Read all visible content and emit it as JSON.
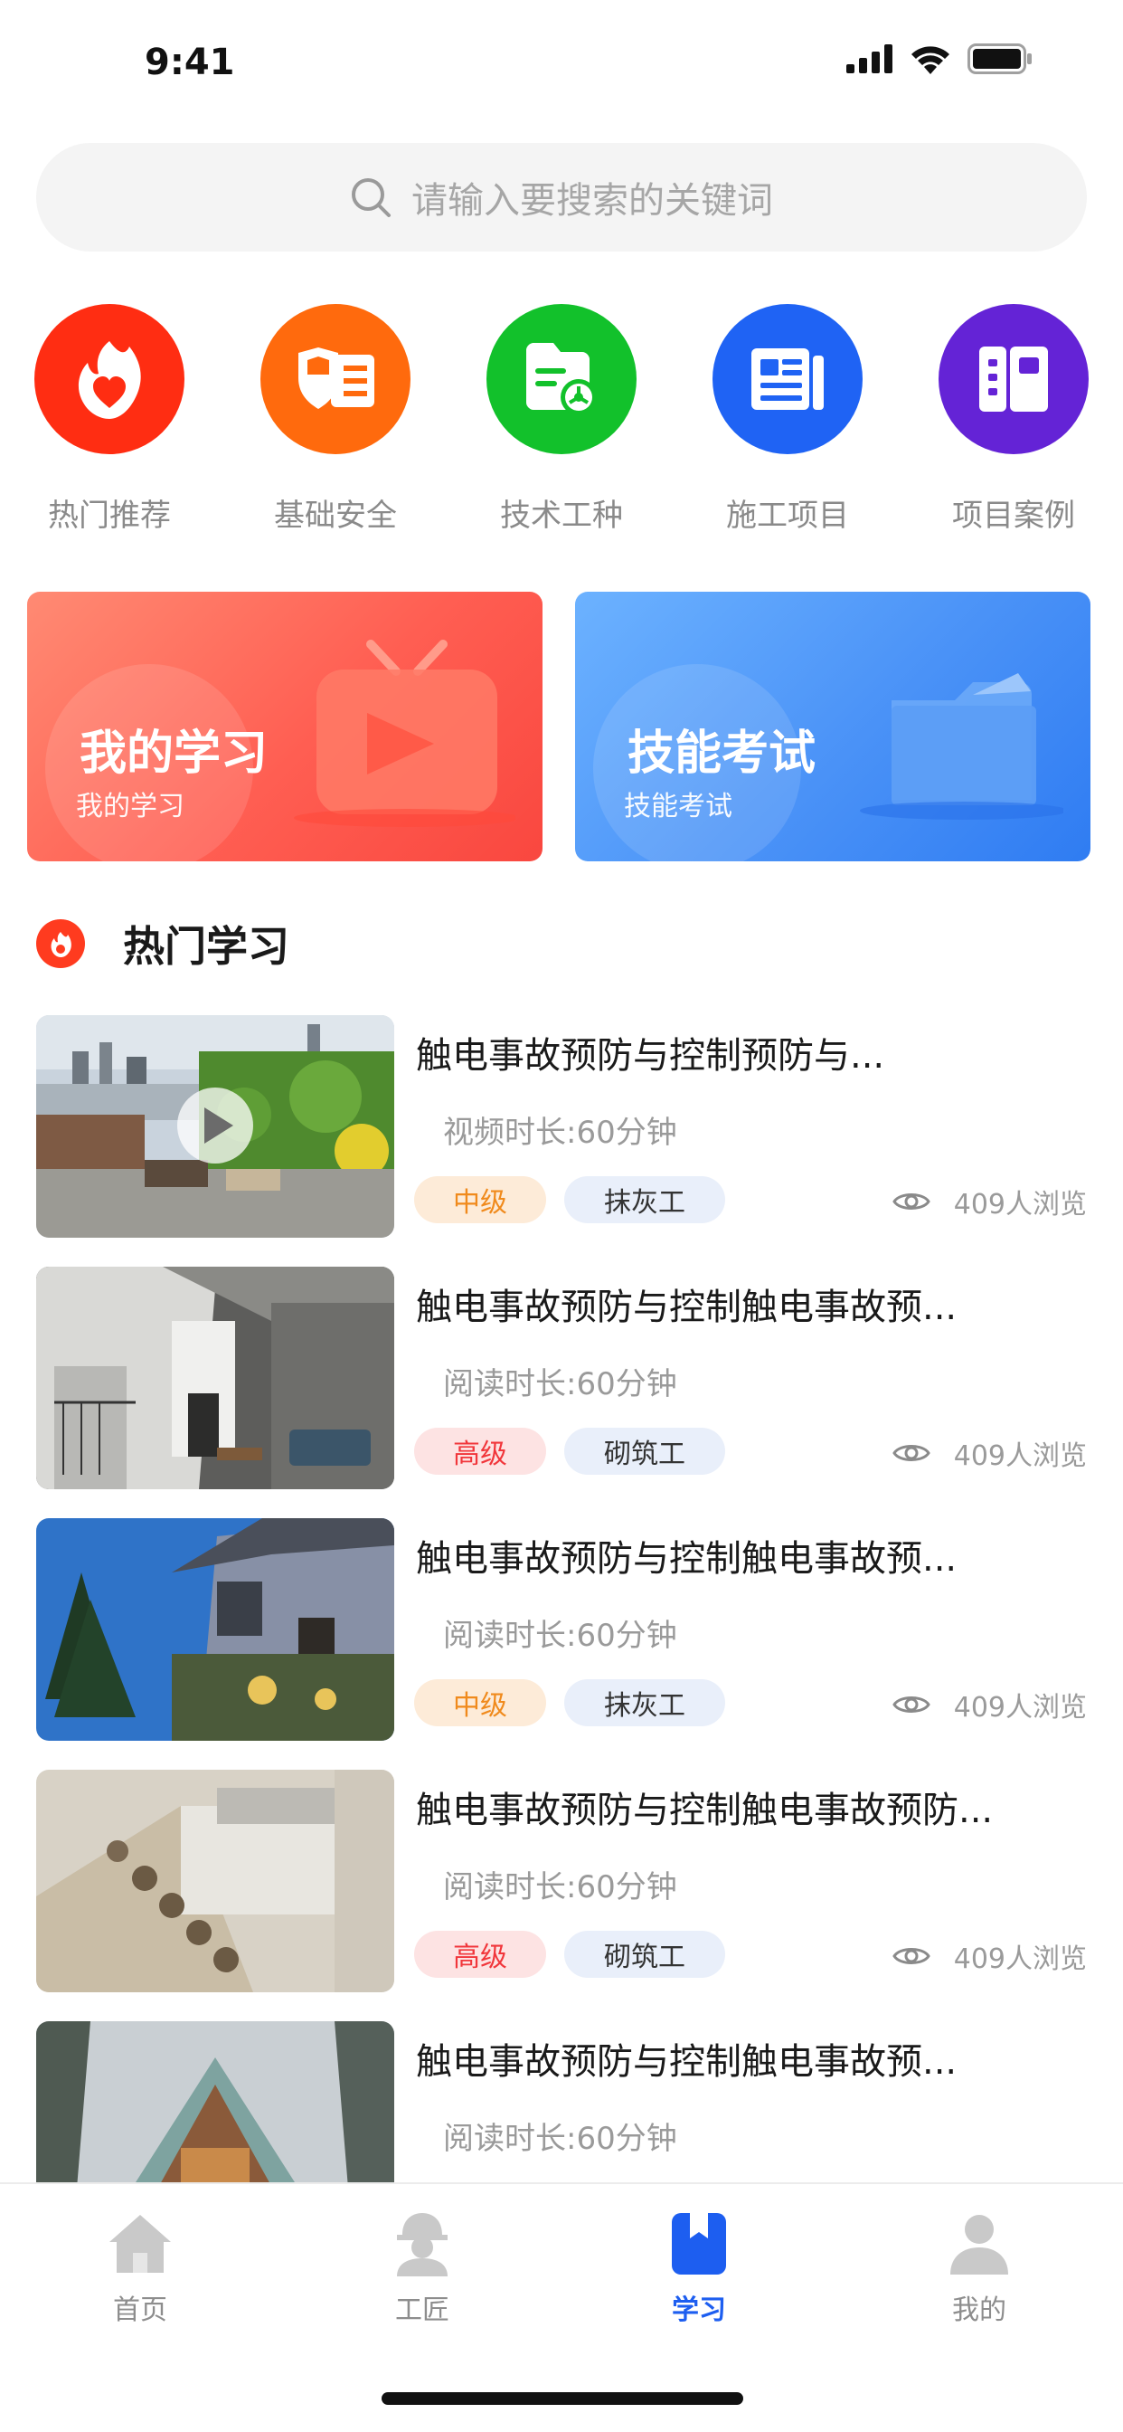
{
  "status_bar": {
    "time": "9:41"
  },
  "search": {
    "placeholder": "请输入要搜索的关键词",
    "icon": "search-icon"
  },
  "categories": [
    {
      "label": "热门推荐",
      "color": "#ff2d12",
      "icon": "flame-heart-icon"
    },
    {
      "label": "基础安全",
      "color": "#ff6a0d",
      "icon": "shield-card-icon"
    },
    {
      "label": "技术工种",
      "color": "#12c12b",
      "icon": "folder-gear-icon"
    },
    {
      "label": "施工项目",
      "color": "#1f63f4",
      "icon": "newspaper-icon"
    },
    {
      "label": "项目案例",
      "color": "#6423d6",
      "icon": "book-case-icon"
    }
  ],
  "banners": {
    "my_learning": {
      "title": "我的学习",
      "subtitle": "我的学习",
      "icon": "tv-play-icon"
    },
    "skill_exam": {
      "title": "技能考试",
      "subtitle": "技能考试",
      "icon": "folder-icon"
    }
  },
  "hot_section": {
    "title": "热门学习",
    "icon": "flame-icon"
  },
  "courses": [
    {
      "title": "触电事故预防与控制预防与...",
      "duration": "视频时长:60分钟",
      "level": "中级",
      "trade": "抹灰工",
      "views": "409人浏览",
      "is_video": true
    },
    {
      "title": "触电事故预防与控制触电事故预...",
      "duration": "阅读时长:60分钟",
      "level": "高级",
      "trade": "砌筑工",
      "views": "409人浏览",
      "is_video": false
    },
    {
      "title": "触电事故预防与控制触电事故预...",
      "duration": "阅读时长:60分钟",
      "level": "中级",
      "trade": "抹灰工",
      "views": "409人浏览",
      "is_video": false
    },
    {
      "title": "触电事故预防与控制触电事故预防...",
      "duration": "阅读时长:60分钟",
      "level": "高级",
      "trade": "砌筑工",
      "views": "409人浏览",
      "is_video": false
    },
    {
      "title": "触电事故预防与控制触电事故预...",
      "duration": "阅读时长:60分钟",
      "level": "",
      "trade": "",
      "views": "",
      "is_video": false
    }
  ],
  "tabs": [
    {
      "label": "首页",
      "icon": "home-icon",
      "active": false
    },
    {
      "label": "工匠",
      "icon": "worker-icon",
      "active": false
    },
    {
      "label": "学习",
      "icon": "bookmark-icon",
      "active": true
    },
    {
      "label": "我的",
      "icon": "user-icon",
      "active": false
    }
  ],
  "colors": {
    "accent": "#1d5ef0",
    "tag_mid": "#f08a1c",
    "tag_high": "#f1363b"
  }
}
